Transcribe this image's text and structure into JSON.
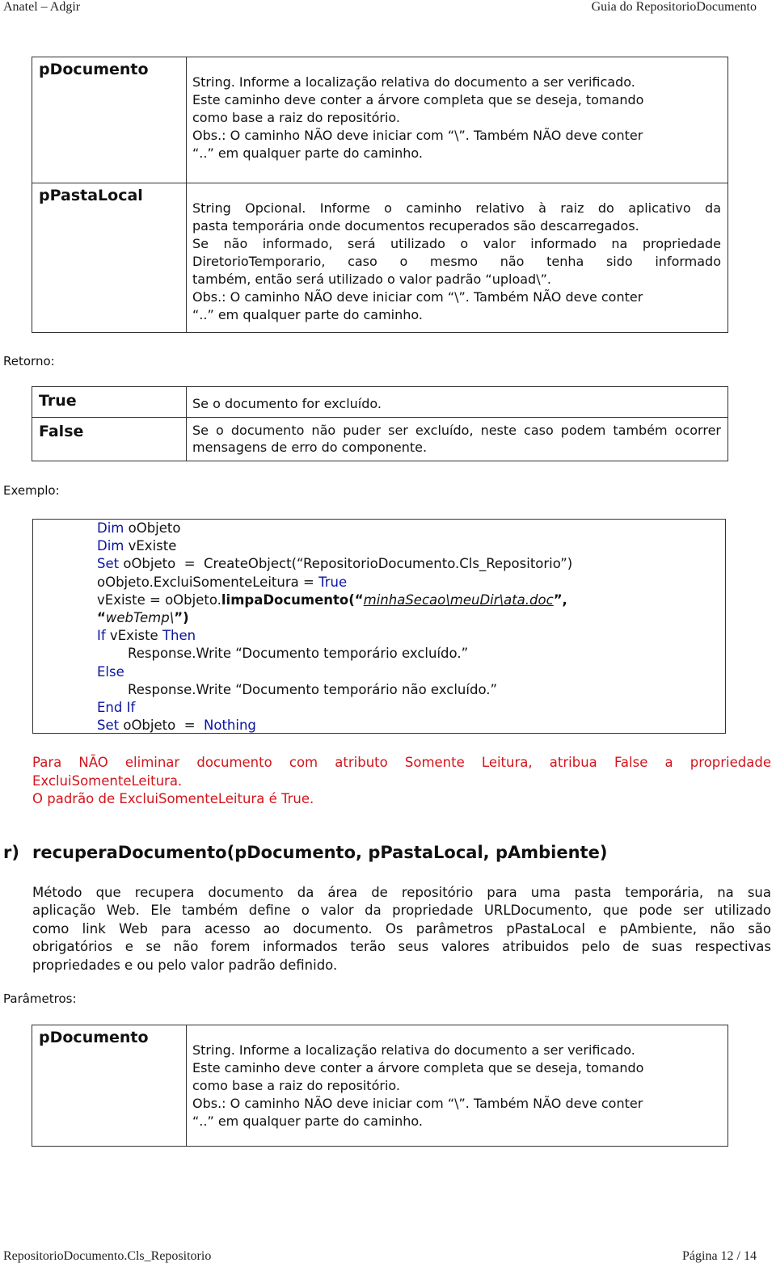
{
  "header": {
    "left": "Anatel – Adgir",
    "right": "Guia do RepositorioDocumento"
  },
  "params_table_1": [
    {
      "name": "pDocumento",
      "lines": [
        "String. Informe a localização relativa do documento a ser verificado.",
        "Este caminho deve conter a árvore completa que se deseja, tomando",
        "como base a raiz do repositório.",
        "Obs.: O caminho NÃO deve iniciar com “\\”. Também NÃO deve conter",
        "“..” em qualquer parte do caminho."
      ]
    },
    {
      "name": "pPastaLocal",
      "lines": [
        "String Opcional. Informe o caminho relativo à raiz do aplicativo da",
        "pasta temporária onde documentos recuperados são descarregados.",
        "Se não informado, será utilizado o valor informado na propriedade",
        "DiretorioTemporario, caso o mesmo não tenha sido informado",
        "também, então será utilizado o valor padrão “upload\\”.",
        "Obs.: O caminho NÃO deve iniciar com “\\”. Também NÃO deve conter",
        "“..” em qualquer parte do caminho."
      ]
    }
  ],
  "return_label": "Retorno:",
  "return_table": [
    {
      "name": "True",
      "text": "Se o documento for excluído."
    },
    {
      "name": "False",
      "text": "Se o documento não puder ser excluído, neste caso podem também ocorrer mensagens de erro do componente."
    }
  ],
  "example_label": "Exemplo:",
  "code": {
    "l1_kw": "Dim",
    "l1_rest": " oObjeto",
    "l2_kw": "Dim",
    "l2_rest": " vExiste",
    "l3_kw": "Set",
    "l3_rest": " oObjeto  =  CreateObject(“RepositorioDocumento.Cls_Repositorio”)",
    "l4_a": "oObjeto.ExcluiSomenteLeitura = ",
    "l4_kw": "True",
    "l5_a": "vExiste = oObjeto.",
    "l5_fn": "limpaDocumento(“",
    "l5_arg": "minhaSecao\\meuDir\\ata.doc",
    "l5_end": "”,",
    "l6_q1": "“",
    "l6_arg": "webTemp\\",
    "l6_end": "”)",
    "l7_kw1": "If",
    "l7_mid": " vExiste ",
    "l7_kw2": "Then",
    "l8": "Response.Write “Documento temporário excluído.”",
    "l9_kw": "Else",
    "l10": "Response.Write “Documento temporário não excluído.”",
    "l11_kw": "End If",
    "l12_kw": "Set",
    "l12_mid": " oObjeto  =  ",
    "l12_kw2": "Nothing"
  },
  "note": {
    "line1": "Para NÃO eliminar documento com atributo Somente Leitura, atribua False a propriedade",
    "line2": "ExcluiSomenteLeitura.",
    "line3": "O padrão de ExcluiSomenteLeitura é True."
  },
  "section": {
    "number": "r)",
    "title": "recuperaDocumento(pDocumento, pPastaLocal, pAmbiente)",
    "intro_lines": [
      "Método que recupera documento da área de repositório para uma pasta temporária, na sua",
      "aplicação Web. Ele também define o valor da propriedade URLDocumento, que pode ser utilizado",
      "como link Web para acesso ao documento. Os parâmetros pPastaLocal e pAmbiente, não são",
      "obrigatórios e se não forem informados terão seus valores atribuidos pelo de suas respectivas",
      "propriedades e ou pelo valor padrão definido."
    ]
  },
  "params_label": "Parâmetros:",
  "params_table_2": [
    {
      "name": "pDocumento",
      "lines": [
        "String. Informe a localização relativa do documento a ser verificado.",
        "Este caminho deve conter a árvore completa que se deseja, tomando",
        "como base a raiz do repositório.",
        "Obs.: O caminho NÃO deve iniciar com “\\”. Também NÃO deve conter",
        "“..” em qualquer parte do caminho."
      ]
    }
  ],
  "footer": {
    "left": "RepositorioDocumento.Cls_Repositorio",
    "right": "Página 12 / 14"
  },
  "colors": {
    "keyword": "#0a14a0",
    "note": "#d3141c",
    "text": "#111111"
  }
}
